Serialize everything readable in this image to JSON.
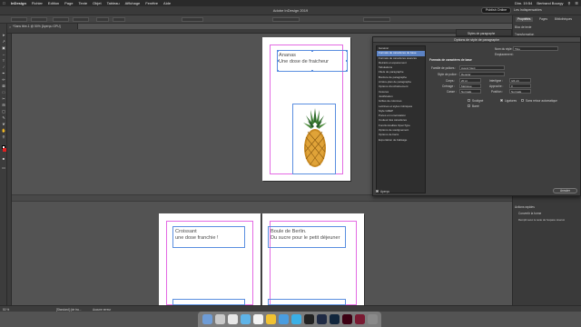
{
  "menubar": {
    "app": "InDesign",
    "items": [
      "Fichier",
      "Edition",
      "Page",
      "Texte",
      "Objet",
      "Tableau",
      "Affichage",
      "Fenêtre",
      "Aide"
    ],
    "clock": "Dim. 19:54",
    "user": "Bertrand Bourgy"
  },
  "appbar": {
    "title": "Adobe InDesign 2019",
    "publish": "Publish Online",
    "workspace": "Les Indispensables"
  },
  "document": {
    "tab": "*Sans titre-1 @ 50% [Aperçu GPU]",
    "frames": {
      "ananas_line1": "Ananas",
      "ananas_line2": "Une dose de fraicheur",
      "croissant_line1": "Croissant",
      "croissant_line2": "une dose franchie !",
      "boule_line1": "Boule de Berlin.",
      "boule_line2": "Du sucre pour le petit déjeuner"
    }
  },
  "dialog": {
    "title": "Options de style de paragraphe",
    "list": [
      "Général",
      "Formats de caractères de base",
      "Formats de caractères avancés",
      "Retraits et espacement",
      "Tabulations",
      "Filets de paragraphe",
      "Bordure de paragraphe",
      "Arrière-plan de paragraphe",
      "Options d'enchaînement",
      "Césures",
      "Justification",
      "Grilles de colonnes",
      "Lettrines et styles imbriqués",
      "Style GREP",
      "Puces et numérotation",
      "Couleur des caractères",
      "Fonctionnalités OpenType",
      "Options de soulignement",
      "Options de barré",
      "Exportation de balisage"
    ],
    "selected_index": 1,
    "style_name_label": "Nom du style :",
    "style_name_value": "Titre",
    "location_label": "Emplacement :",
    "section_title": "Formats de caractères de base",
    "fields": {
      "font_family_label": "Famille de polices :",
      "font_family_value": "Avenir Next",
      "font_style_label": "Style de police :",
      "font_style_value": "Regular",
      "size_label": "Corps :",
      "size_value": "20 pt",
      "leading_label": "Interligne :",
      "leading_value": "(24 pt)",
      "kerning_label": "Crénage :",
      "kerning_value": "Métrique",
      "tracking_label": "Approche :",
      "tracking_value": "0",
      "case_label": "Casse :",
      "case_value": "Normale",
      "position_label": "Position :",
      "position_value": "Normale"
    },
    "checkboxes": {
      "underline": "Souligné",
      "ligatures": "Ligatures",
      "no_break": "Sans retour automatique",
      "strikethrough": "Barré"
    },
    "preview_label": "Aperçu",
    "cancel": "Annuler",
    "ok": "OK"
  },
  "panels": {
    "tabs": [
      "Propriétés",
      "Pages",
      "Bibliothèques"
    ],
    "styles_tab": "Styles de paragraphe",
    "rows": [
      "Bloc de texte",
      "Transformation"
    ],
    "bottom_rows": [
      "Actions rapides",
      "Convertir la forme",
      "Remplir avec le texte de l'espace réservé"
    ]
  },
  "statusbar": {
    "zoom": "50 %",
    "profile": "[Standard] (de tra...",
    "errors": "Aucune erreur"
  },
  "dock": {
    "colors": [
      "#6e9cd6",
      "#c9c9c9",
      "#e8e8e8",
      "#5fb4e8",
      "#f2f2f2",
      "#f1c232",
      "#4a9de0",
      "#3bb0e6",
      "#222222",
      "#1f2a44",
      "#11263d",
      "#3c0012",
      "#7a1a32",
      "#8a8a8a"
    ]
  }
}
